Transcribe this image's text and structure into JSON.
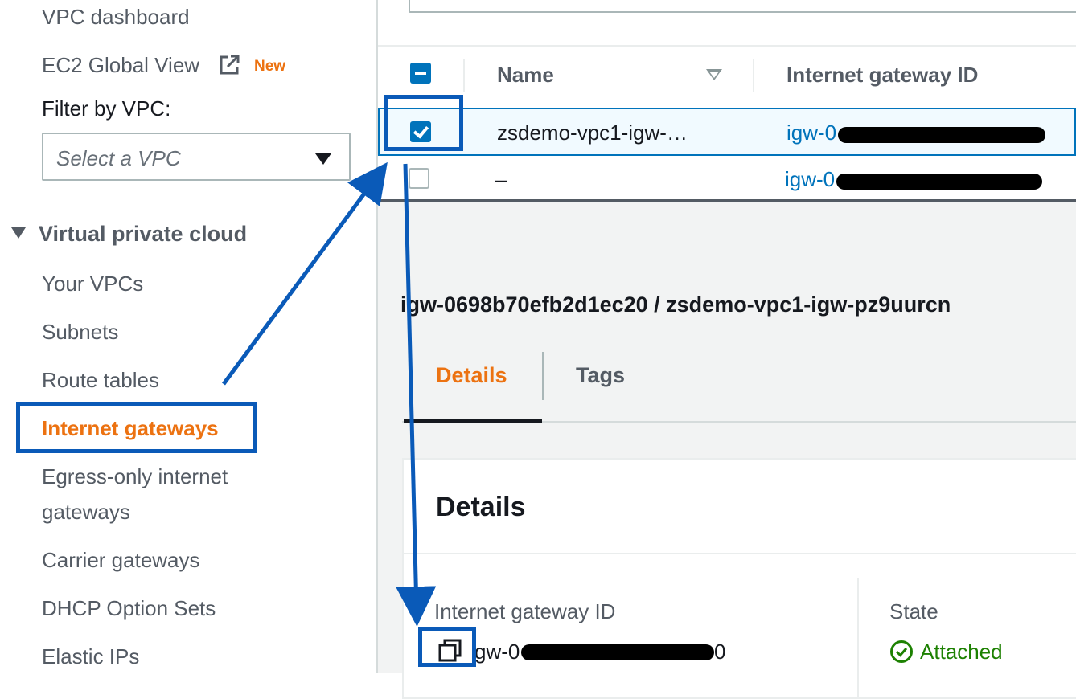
{
  "sidebar": {
    "top_items": [
      {
        "label": "VPC dashboard"
      },
      {
        "label": "EC2 Global View",
        "badge": "New"
      }
    ],
    "filter_label": "Filter by VPC:",
    "filter_placeholder": "Select a VPC",
    "section_title": "Virtual private cloud",
    "items": [
      {
        "label": "Your VPCs"
      },
      {
        "label": "Subnets"
      },
      {
        "label": "Route tables"
      },
      {
        "label": "Internet gateways",
        "active": true
      },
      {
        "label": "Egress-only internet",
        "label_line2": "gateways"
      },
      {
        "label": "Carrier gateways"
      },
      {
        "label": "DHCP Option Sets"
      },
      {
        "label": "Elastic IPs"
      }
    ]
  },
  "table": {
    "columns": [
      "Name",
      "Internet gateway ID"
    ],
    "rows": [
      {
        "name": "zsdemo-vpc1-igw-…",
        "id_visible": "igw-0",
        "selected": true
      },
      {
        "name": "–",
        "id_visible": "igw-0",
        "selected": false
      }
    ]
  },
  "detail": {
    "title": "igw-0698b70efb2d1ec20 / zsdemo-vpc1-igw-pz9uurcn",
    "tabs": [
      "Details",
      "Tags"
    ],
    "card_title": "Details",
    "fields": {
      "igw_label": "Internet gateway ID",
      "igw_value_visible": "gw-0",
      "igw_value_tail": "0",
      "state_label": "State",
      "state_value": "Attached"
    }
  },
  "colors": {
    "accent": "#ec7211",
    "link": "#0073bb",
    "annotation": "#0a5ab8",
    "success": "#1d8102"
  }
}
